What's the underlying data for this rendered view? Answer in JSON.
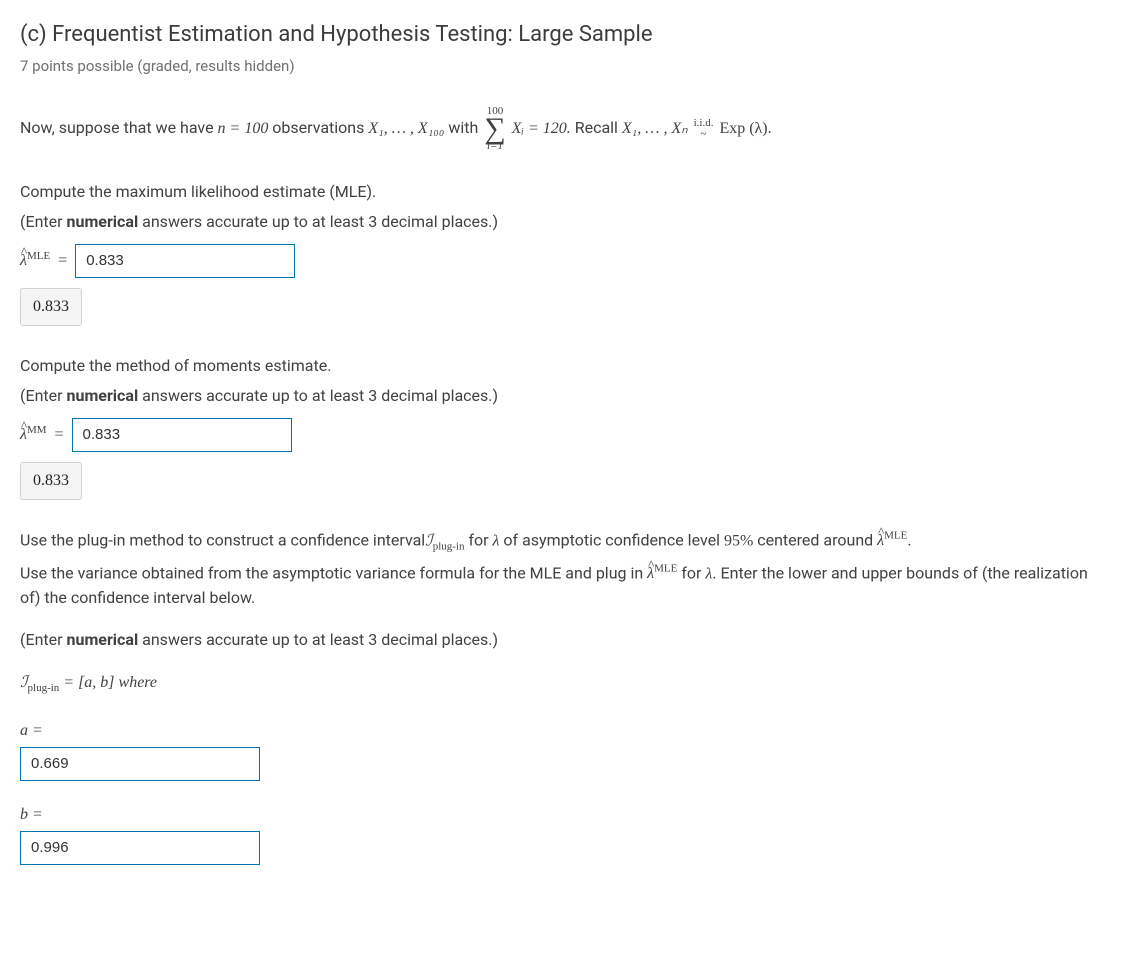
{
  "title": "(c) Frequentist Estimation and Hypothesis Testing: Large Sample",
  "subtitle": "7 points possible (graded, results hidden)",
  "intro": {
    "prefix": "Now, suppose that we have ",
    "n_eq": "n = 100",
    "obs_text": " observations ",
    "xrange": "X₁, … , X₁₀₀",
    "with": "with ",
    "sum_top": "100",
    "sum_bot": "i=1",
    "sum_body": "Xᵢ = 120.",
    "recall": " Recall ",
    "xrange2": "X₁, … , Xₙ",
    "iid_top": "i.i.d.",
    "iid_bot": "~",
    "dist": "Exp (λ)."
  },
  "q1": {
    "line1": "Compute the maximum likelihood estimate (MLE).",
    "line2_pre": "(Enter ",
    "line2_bold": "numerical",
    "line2_post": " answers accurate up to at least 3 decimal places.)",
    "label_sup": "MLE",
    "eq": " =",
    "value": "0.833",
    "feedback": "0.833"
  },
  "q2": {
    "line1": "Compute the method of moments estimate.",
    "line2_pre": "(Enter ",
    "line2_bold": "numerical",
    "line2_post": " answers accurate up to at least 3 decimal places.)",
    "label_sup": "MM",
    "eq": " =",
    "value": "0.833",
    "feedback": "0.833"
  },
  "q3": {
    "p1_a": "Use the plug-in method to construct a confidence interval",
    "p1_I": "ℐ",
    "p1_Isub": "plug-in",
    "p1_b": "for ",
    "p1_lam": "λ",
    "p1_c": " of asymptotic confidence level ",
    "p1_pct": "95%",
    "p1_d": " centered around ",
    "p1_sup": "MLE",
    "p1_e": ".",
    "p2_a": "Use the variance obtained from the asymptotic variance formula for the MLE and plug in ",
    "p2_sup": "MLE",
    "p2_b": "for ",
    "p2_lam": "λ",
    "p2_c": ". Enter the lower and upper bounds of (the realization of) the confidence interval below.",
    "p3_pre": "(Enter ",
    "p3_bold": "numerical",
    "p3_post": " answers accurate up to at least 3 decimal places.)",
    "interval_label_a": "ℐ",
    "interval_label_sub": "plug-in",
    "interval_label_b": "= [a, b] where",
    "a_label": "a =",
    "a_value": "0.669",
    "b_label": "b =",
    "b_value": "0.996"
  }
}
